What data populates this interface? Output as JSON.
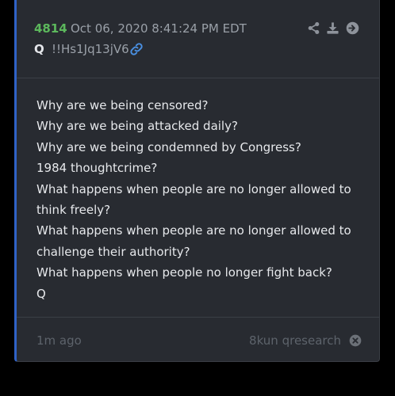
{
  "post": {
    "number": "4814",
    "date": "Oct 06, 2020 8:41:24 PM EDT",
    "author": "Q",
    "tripcode": "!!Hs1Jq13jV6"
  },
  "header_icons": [
    "share-icon",
    "download-icon",
    "forward-icon",
    "link-icon"
  ],
  "body": {
    "lines": [
      "Why are we being censored?",
      "Why are we being attacked daily?",
      "Why are we being condemned by Congress?",
      "1984 thoughtcrime?",
      "What happens when people are no longer allowed to",
      "think freely?",
      "What happens when people are no longer allowed to",
      "challenge their authority?",
      "What happens when people no longer fight back?",
      "Q"
    ]
  },
  "footer": {
    "timeago": "1m ago",
    "source": "8kun qresearch",
    "close_icon": "close-circle-icon"
  },
  "colors": {
    "background": "#000000",
    "card": "#282b31",
    "accent_border": "#2f62c7",
    "post_number": "#5cb85c",
    "link": "#4a90e2",
    "muted": "#9aa0a8",
    "footer_text": "#5d636b"
  }
}
